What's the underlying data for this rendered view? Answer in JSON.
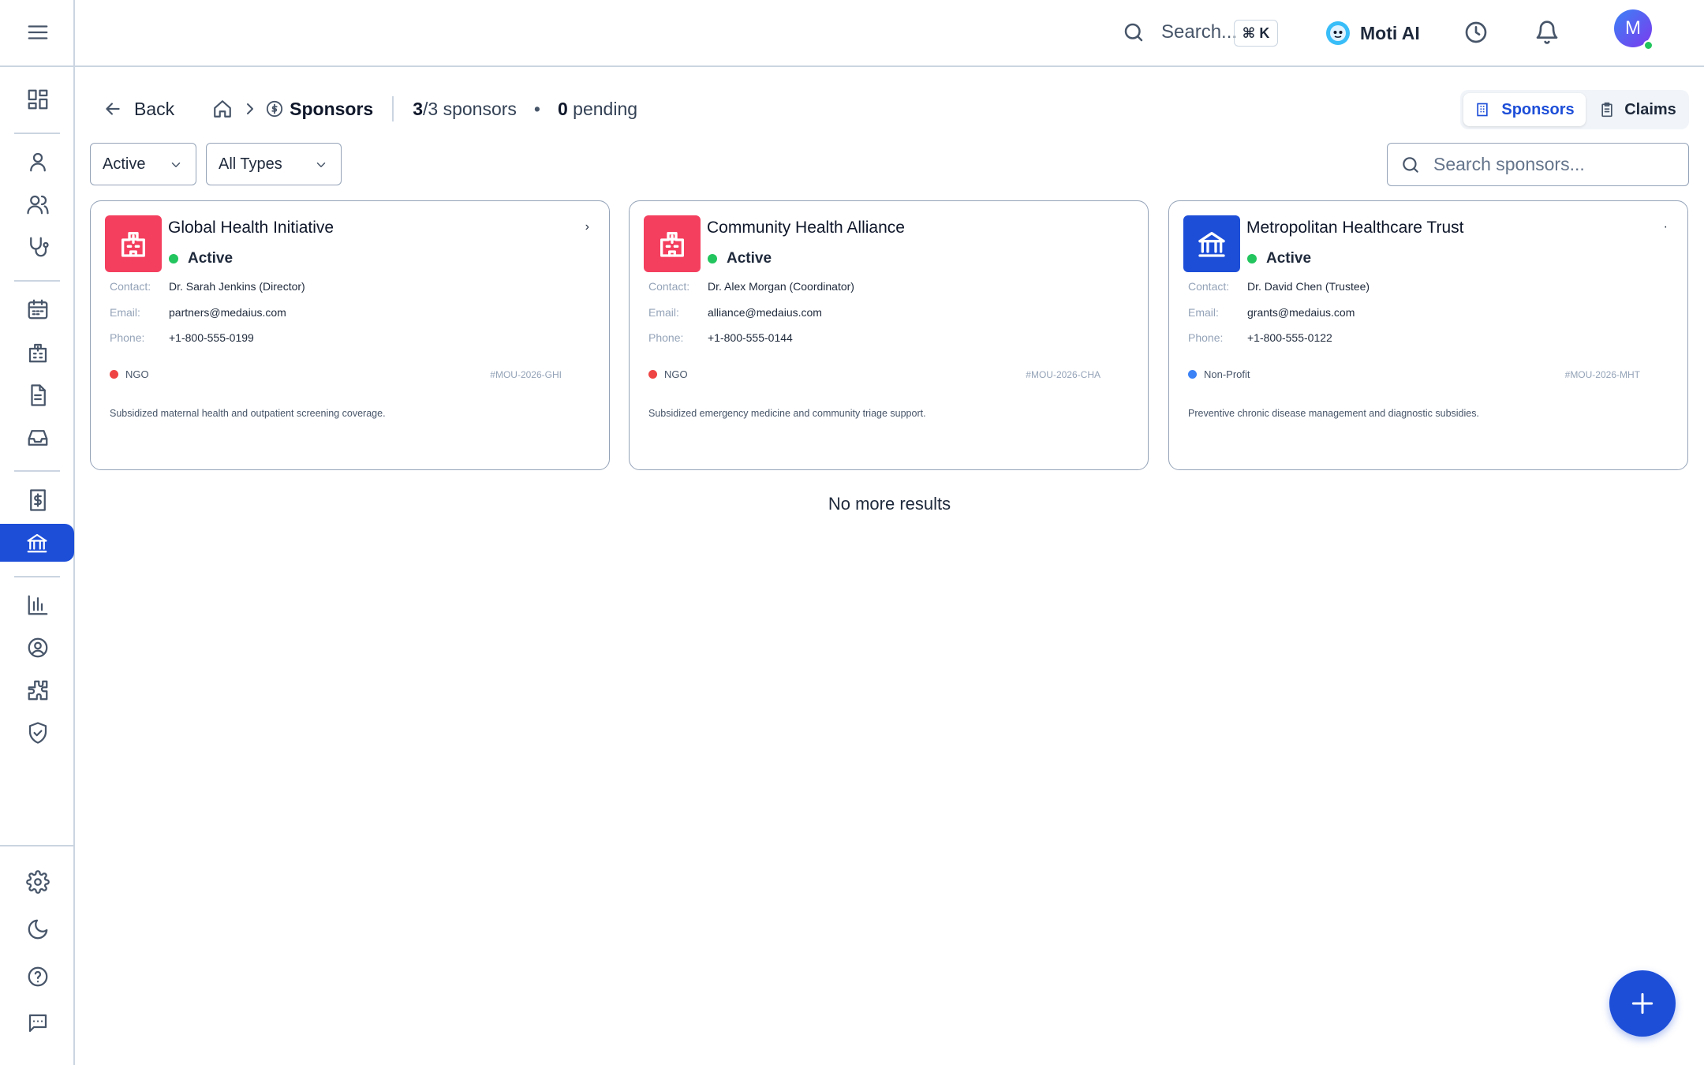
{
  "topbar": {
    "search_placeholder": "Search...",
    "shortcut": "⌘ K",
    "ai_label": "Moti AI",
    "avatar_initial": "M"
  },
  "breadcrumb": {
    "back_label": "Back",
    "current": "Sponsors",
    "count_visible": "3",
    "count_total_text": "/3 sponsors",
    "bullet": "•",
    "pending_count": "0",
    "pending_text": " pending"
  },
  "view_toggle": {
    "sponsors_label": "Sponsors",
    "claims_label": "Claims",
    "active": "Sponsors"
  },
  "filters": {
    "status_value": "Active",
    "type_value": "All Types",
    "search_placeholder": "Search sponsors..."
  },
  "sponsors": [
    {
      "name": "Global Health Initiative",
      "status": "Active",
      "contact_label": "Contact:",
      "contact": "Dr. Sarah Jenkins (Director)",
      "email_label": "Email:",
      "email": "partners@medaius.com",
      "phone_label": "Phone:",
      "phone": "+1-800-555-0199",
      "type": "NGO",
      "ref": "#MOU-2026-GHI",
      "description": "Subsidized maternal health and outpatient screening coverage.",
      "icon": "hospital-icon",
      "icon_color": "#f43f5e",
      "type_color": "#ef4444",
      "chevron": "›"
    },
    {
      "name": "Community Health Alliance",
      "status": "Active",
      "contact_label": "Contact:",
      "contact": "Dr. Alex Morgan (Coordinator)",
      "email_label": "Email:",
      "email": "alliance@medaius.com",
      "phone_label": "Phone:",
      "phone": "+1-800-555-0144",
      "type": "NGO",
      "ref": "#MOU-2026-CHA",
      "description": "Subsidized emergency medicine and community triage support.",
      "icon": "hospital-icon",
      "icon_color": "#f43f5e",
      "type_color": "#ef4444",
      "chevron": ""
    },
    {
      "name": "Metropolitan Healthcare Trust",
      "status": "Active",
      "contact_label": "Contact:",
      "contact": "Dr. David Chen (Trustee)",
      "email_label": "Email:",
      "email": "grants@medaius.com",
      "phone_label": "Phone:",
      "phone": "+1-800-555-0122",
      "type": "Non-Profit",
      "ref": "#MOU-2026-MHT",
      "description": "Preventive chronic disease management and diagnostic subsidies.",
      "icon": "bank-icon",
      "icon_color": "#1d4ed8",
      "type_color": "#3b82f6",
      "chevron": "·"
    }
  ],
  "list_end_text": "No more results",
  "colors": {
    "primary": "#1d4ed8",
    "active_dot": "#22c55e",
    "border": "#94a3b8"
  }
}
